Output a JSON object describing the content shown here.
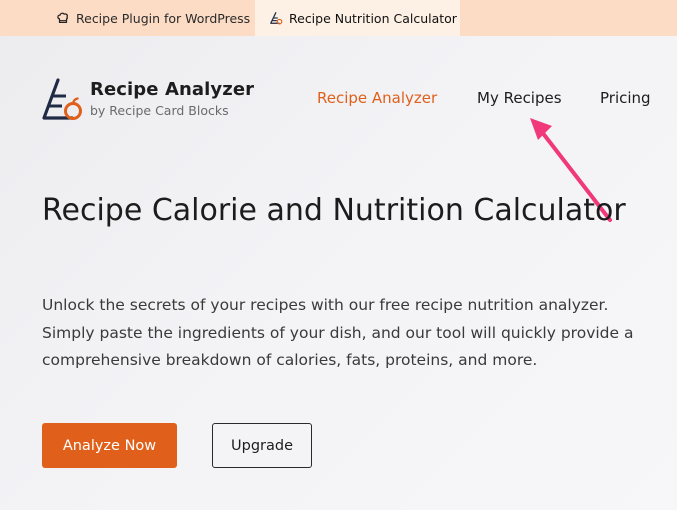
{
  "tabs": [
    {
      "label": "Recipe Plugin for WordPress",
      "icon": "chef-hat-icon",
      "active": false
    },
    {
      "label": "Recipe Nutrition Calculator",
      "icon": "pyramid-logo-icon",
      "active": true
    }
  ],
  "brand": {
    "title": "Recipe Analyzer",
    "subtitle": "by Recipe Card Blocks",
    "icon": "recipe-analyzer-logo",
    "accent_color": "#e0601b",
    "dark_color": "#1f2a44"
  },
  "nav": {
    "items": [
      {
        "label": "Recipe Analyzer",
        "active": true
      },
      {
        "label": "My Recipes",
        "active": false
      },
      {
        "label": "Pricing",
        "active": false
      }
    ],
    "active_color": "#e0601b"
  },
  "annotation": {
    "icon": "pink-arrow-icon",
    "color": "#f0387a"
  },
  "hero": {
    "title": "Recipe Calorie and Nutrition Calculator",
    "description": "Unlock the secrets of your recipes with our free recipe nutrition analyzer. Simply paste the ingredients of your dish, and our tool will quickly provide a comprehensive breakdown of calories, fats, proteins, and more.",
    "primary_button": "Analyze Now",
    "secondary_button": "Upgrade"
  },
  "colors": {
    "topbar_bg": "#fcdcc4",
    "active_tab_bg": "#fdf0e5",
    "primary_button_bg": "#e0601b"
  }
}
